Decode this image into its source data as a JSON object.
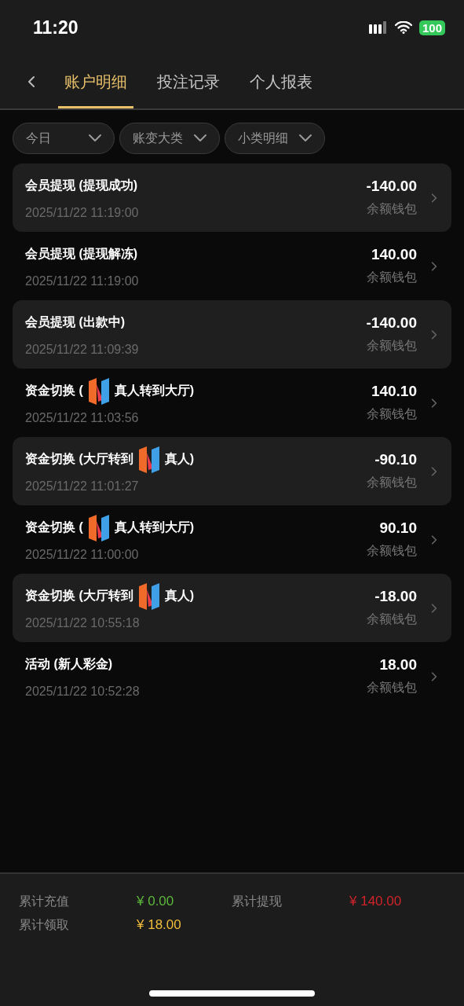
{
  "status_bar": {
    "time": "11:20",
    "battery": "100"
  },
  "tabs": [
    {
      "label": "账户明细",
      "selected": true
    },
    {
      "label": "投注记录",
      "selected": false
    },
    {
      "label": "个人报表",
      "selected": false
    }
  ],
  "filters": [
    {
      "label": "今日"
    },
    {
      "label": "账变大类"
    },
    {
      "label": "小类明细"
    }
  ],
  "rows": [
    {
      "shaded": true,
      "title": [
        {
          "kind": "text",
          "text": "会员提现 (提现成功)"
        }
      ],
      "time": "2025/11/22 11:19:00",
      "amount": "-140.00",
      "wallet": "余额钱包"
    },
    {
      "shaded": false,
      "title": [
        {
          "kind": "text",
          "text": "会员提现 (提现解冻)"
        }
      ],
      "time": "2025/11/22 11:19:00",
      "amount": "140.00",
      "wallet": "余额钱包"
    },
    {
      "shaded": true,
      "title": [
        {
          "kind": "text",
          "text": "会员提现 (出款中)"
        }
      ],
      "time": "2025/11/22 11:09:39",
      "amount": "-140.00",
      "wallet": "余额钱包"
    },
    {
      "shaded": false,
      "title": [
        {
          "kind": "text",
          "text": "资金切换 ("
        },
        {
          "kind": "logo"
        },
        {
          "kind": "text",
          "text": "真人转到大厅)"
        }
      ],
      "time": "2025/11/22 11:03:56",
      "amount": "140.10",
      "wallet": "余额钱包"
    },
    {
      "shaded": true,
      "title": [
        {
          "kind": "text",
          "text": "资金切换 (大厅转到"
        },
        {
          "kind": "logo"
        },
        {
          "kind": "text",
          "text": "真人)"
        }
      ],
      "time": "2025/11/22 11:01:27",
      "amount": "-90.10",
      "wallet": "余额钱包"
    },
    {
      "shaded": false,
      "title": [
        {
          "kind": "text",
          "text": "资金切换 ("
        },
        {
          "kind": "logo"
        },
        {
          "kind": "text",
          "text": "真人转到大厅)"
        }
      ],
      "time": "2025/11/22 11:00:00",
      "amount": "90.10",
      "wallet": "余额钱包"
    },
    {
      "shaded": true,
      "title": [
        {
          "kind": "text",
          "text": "资金切换 (大厅转到"
        },
        {
          "kind": "logo"
        },
        {
          "kind": "text",
          "text": "真人)"
        }
      ],
      "time": "2025/11/22 10:55:18",
      "amount": "-18.00",
      "wallet": "余额钱包"
    },
    {
      "shaded": false,
      "title": [
        {
          "kind": "text",
          "text": "活动 (新人彩金)"
        }
      ],
      "time": "2025/11/22 10:52:28",
      "amount": "18.00",
      "wallet": "余额钱包"
    }
  ],
  "summary": [
    {
      "label": "累计充值",
      "value": "¥ 0.00",
      "color": "#5cb83a"
    },
    {
      "label": "累计提现",
      "value": "¥ 140.00",
      "color": "#d0232a"
    },
    {
      "label": "累计领取",
      "value": "¥ 18.00",
      "color": "#f2bd3a"
    }
  ]
}
